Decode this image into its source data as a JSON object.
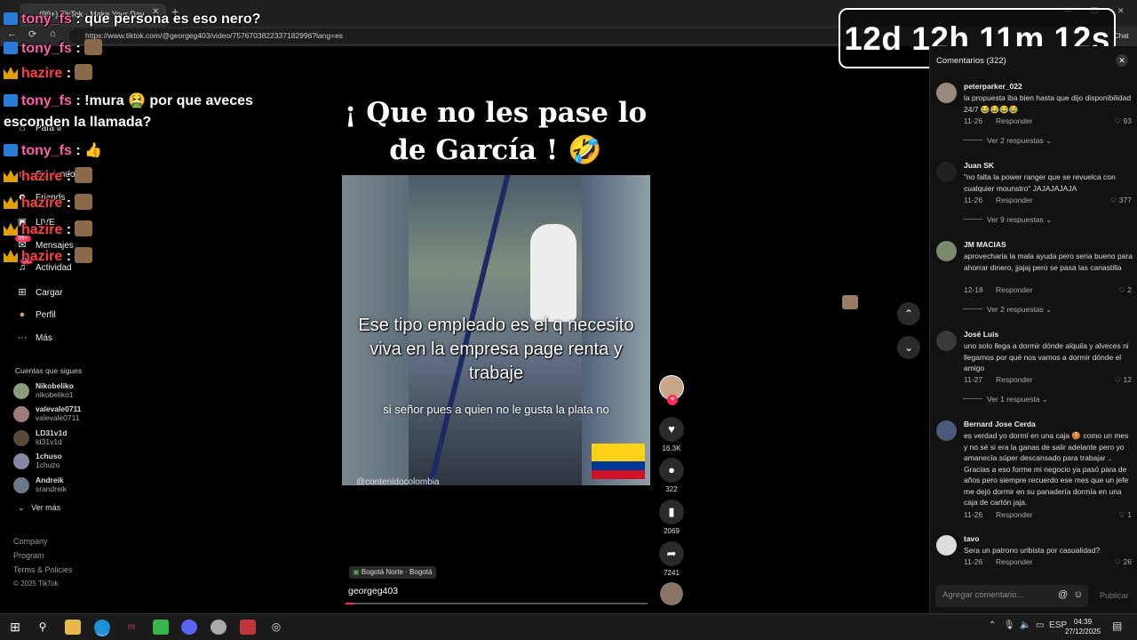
{
  "browser": {
    "tab_title": "(99+) TikTok - Make Your Day",
    "url": "https://www.tiktok.com/@georgeg403/video/7576703822337182996?lang=es",
    "chat_button": "Chat"
  },
  "left_nav": {
    "items": [
      {
        "icon": "home-icon",
        "label": "Para ti"
      },
      {
        "icon": "users-icon",
        "label": "Siguiendo"
      },
      {
        "icon": "friends-icon",
        "label": "Friends"
      },
      {
        "icon": "live-icon",
        "label": "LIVE"
      },
      {
        "icon": "message-icon",
        "label": "Mensajes"
      },
      {
        "icon": "bell-icon",
        "label": "Actividad"
      },
      {
        "icon": "plus-icon",
        "label": "Cargar"
      },
      {
        "icon": "profile-icon",
        "label": "Perfil"
      },
      {
        "icon": "more-icon",
        "label": "Más"
      }
    ],
    "messages_badge": "99+",
    "activity_badge": "20",
    "following_title": "Cuentas que sigues",
    "following": [
      {
        "name": "Nikobeliko",
        "handle": "nikobeliko1"
      },
      {
        "name": "valevale0711",
        "handle": "valevale0711"
      },
      {
        "name": "LD31v1d",
        "handle": "ld31v1d"
      },
      {
        "name": "1chuso",
        "handle": "1chuzo"
      },
      {
        "name": "Andreik",
        "handle": "srandreik"
      }
    ],
    "see_more": "Ver más",
    "footer": [
      "Company",
      "Program",
      "Terms & Policies"
    ],
    "copyright": "© 2025 TikTok"
  },
  "chat_overlay": [
    {
      "user": "tony_fs",
      "message": ": que persona es eso nero?"
    },
    {
      "user": "tony_fs",
      "message": ":"
    },
    {
      "user": "hazire",
      "message": ":"
    },
    {
      "user": "tony_fs",
      "message": ": !mura 🤮 por que aveces"
    },
    {
      "user": "",
      "message": "esconden la llamada?"
    },
    {
      "user": "tony_fs",
      "message": ": 👍"
    },
    {
      "user": "hazire",
      "message": ":"
    },
    {
      "user": "hazire",
      "message": ":"
    },
    {
      "user": "hazire",
      "message": ":"
    },
    {
      "user": "hazire",
      "message": ":"
    }
  ],
  "timer": "12d 12h 11m 12s",
  "video": {
    "caption_top": "¡ Que no les pase lo de García ! 🤣",
    "overlay_text": "Ese tipo empleado es el q necesito viva en la empresa page renta y trabaje",
    "subtitle": "si señor pues a quien no le gusta la plata no",
    "watermark": "@contenidocolombia",
    "location": "Bogotá Norte · Bogotá",
    "author": "georgeg403",
    "progress_fraction": 0.03
  },
  "actions": {
    "likes": "16.3K",
    "comments": "322",
    "saves": "2069",
    "shares": "7241"
  },
  "comments_panel": {
    "title": "Comentarios (322)",
    "reply_label": "Responder",
    "items": [
      {
        "user": "peterparker_022",
        "text": "la propuesta iba bien hasta que dijo disponibilidad 24/7 😂😂😂😂",
        "date": "11-26",
        "likes": "93",
        "more": "Ver 2 respuestas"
      },
      {
        "user": "Juan SK",
        "text": "\"no falta la power ranger que se revuelca con cualquier mounstro\" JAJAJAJAJA",
        "date": "11-26",
        "likes": "377",
        "more": "Ver 9 respuestas"
      },
      {
        "user": "JM MACIAS",
        "text": "aprovecharia la mala ayuda pero seria bueno para ahorrar dinero, jjajaj pero se pasa las canastilla",
        "date": "12-18",
        "likes": "2",
        "more": "Ver 2 respuestas"
      },
      {
        "user": "José Luis",
        "text": "uno solo llega a dormir dónde alquila y alveces ni llegamos por qué nos vamos a dormir dónde el amigo",
        "date": "11-27",
        "likes": "12",
        "more": "Ver 1 respuesta"
      },
      {
        "user": "Bernard Jose Cerda",
        "text": "es verdad yo dormí en una caja 🍪 como un mes y no sé si era la ganas de salir adelante pero yo amanecía súper descansado para trabajar .. Gracias a eso forme mi negocio ya pasó para de años pero siempre recuerdo ese mes que un jefe me dejó dormir en su panadería dormía en una caja de cartón jaja.",
        "date": "11-26",
        "likes": "1",
        "more": ""
      },
      {
        "user": "tavo",
        "text": "Sera un patrono uribista por casualidad?",
        "date": "11-26",
        "likes": "26",
        "more": ""
      }
    ],
    "input_placeholder": "Agregar comentario...",
    "post_label": "Publicar"
  },
  "taskbar": {
    "language": "ESP",
    "time": "04:39",
    "date": "27/12/2025"
  },
  "colors": {
    "accent": "#fe2c55",
    "flag_yellow": "#fcd116",
    "flag_blue": "#003893",
    "flag_red": "#ce1126"
  }
}
